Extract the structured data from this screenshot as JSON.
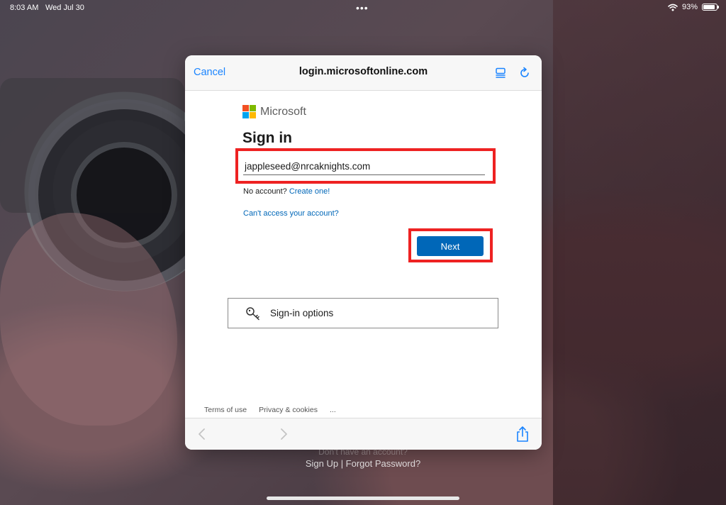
{
  "status_bar": {
    "time": "8:03 AM",
    "date": "Wed Jul 30",
    "battery_percent": "93%",
    "battery_level": 0.93
  },
  "background": {
    "line1": "Don't have an account?",
    "line2": "Sign Up | Forgot Password?"
  },
  "browser": {
    "cancel_label": "Cancel",
    "url": "login.microsoftonline.com",
    "icons": {
      "reader": "reader-mode-icon",
      "reload": "reload-icon",
      "back": "back-chevron-icon",
      "forward": "forward-chevron-icon",
      "share": "share-icon"
    }
  },
  "signin": {
    "brand": "Microsoft",
    "title": "Sign in",
    "email_value": "jappleseed@nrcaknights.com",
    "no_account_text": "No account?",
    "create_link": "Create one!",
    "cant_access_link": "Can't access your account?",
    "next_label": "Next",
    "options_label": "Sign-in options",
    "footer": {
      "terms": "Terms of use",
      "privacy": "Privacy & cookies",
      "more": "..."
    }
  },
  "colors": {
    "accent_blue": "#0067b8",
    "ios_blue": "#1a84ff",
    "highlight_red": "#ee2222",
    "ms_red": "#f25022",
    "ms_green": "#7fba00",
    "ms_blue": "#00a4ef",
    "ms_yellow": "#ffb900"
  }
}
